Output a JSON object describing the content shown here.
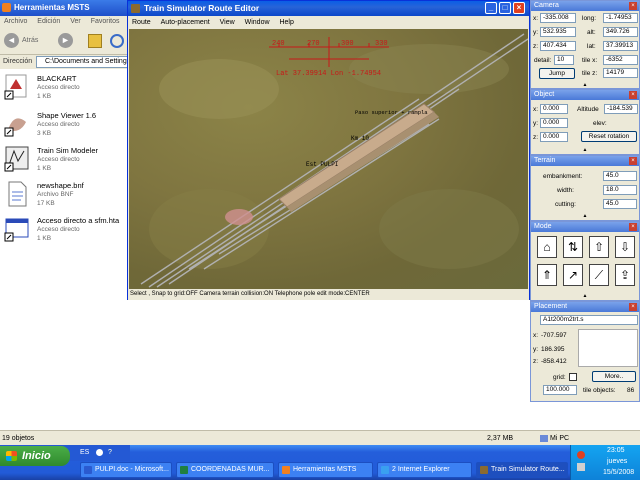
{
  "explorer": {
    "title": "Herramientas MSTS",
    "menu": [
      "Archivo",
      "Edición",
      "Ver",
      "Favoritos"
    ],
    "back_label": "Atrás",
    "address_label": "Dirección",
    "address_value": "C:\\Documents and Settings",
    "files": [
      {
        "name": "BLACKART",
        "type": "Acceso directo",
        "size": "1 KB"
      },
      {
        "name": "Shape Viewer 1.6",
        "type": "Acceso directo",
        "size": "3 KB"
      },
      {
        "name": "Train Sim Modeler",
        "type": "Acceso directo",
        "size": "1 KB"
      },
      {
        "name": "newshape.bnf",
        "type": "Archivo BNF",
        "size": "17 KB"
      },
      {
        "name": "Acceso directo a sfm.hta",
        "type": "Acceso directo",
        "size": "1 KB"
      }
    ],
    "status": {
      "count": "19 objetos",
      "size": "2,37 MB",
      "location": "Mi PC"
    }
  },
  "route_editor": {
    "title": "Train Simulator Route Editor",
    "menu": [
      "Route",
      "Auto-placement",
      "View",
      "Window",
      "Help"
    ],
    "compass": [
      "240",
      "270",
      "300",
      "330"
    ],
    "latlon": "Lat 37.39914 Lon -1.74954",
    "labels": {
      "paso": "Paso superior + rampla",
      "km": "Km 10",
      "est": "Est PULPI"
    },
    "status": "Select , Snap to grid:OFF Camera terrain collision:ON Telephone pole edit mode:CENTER"
  },
  "camera": {
    "title": "Camera",
    "x": "-335.008",
    "y": "532.935",
    "z": "407.434",
    "long": "-1.74953",
    "alt": "349.726",
    "lat": "37.39913",
    "detail_label": "detail:",
    "detail": "10",
    "tile_x": "-6352",
    "tile_z": "14179",
    "jump": "Jump"
  },
  "object": {
    "title": "Object",
    "x": "0.000",
    "y": "0.000",
    "z": "0.000",
    "altitude_label": "Altitude",
    "altitude": "-184.539",
    "elev_label": "elev:",
    "reset": "Reset rotation"
  },
  "terrain": {
    "title": "Terrain",
    "embankment_label": "embankment:",
    "embankment": "45.0",
    "width_label": "width:",
    "width": "18.0",
    "cutting_label": "cutting:",
    "cutting": "45.0"
  },
  "mode": {
    "title": "Mode"
  },
  "placement": {
    "title": "Placement",
    "name": "A1t200m2trt.s",
    "x": "-707.597",
    "y": "186.395",
    "z": "-858.412",
    "grid_label": "grid:",
    "more": "More..",
    "grid_value": "100.000",
    "tile_objects_label": "tile objects:",
    "tile_objects": "86"
  },
  "taskbar": {
    "start": "Inicio",
    "lang": "ES",
    "tasks": [
      "PULPI.doc - Microsoft...",
      "COORDENADAS MUR...",
      "Herramientas MSTS",
      "2 Internet Explorer",
      "Train Simulator Route..."
    ],
    "time": "23:05",
    "day": "jueves",
    "date": "15/5/2008"
  },
  "colors": {
    "accent": "#245edb",
    "overlay_red": "#c81818",
    "track": "#b0b0b0"
  }
}
